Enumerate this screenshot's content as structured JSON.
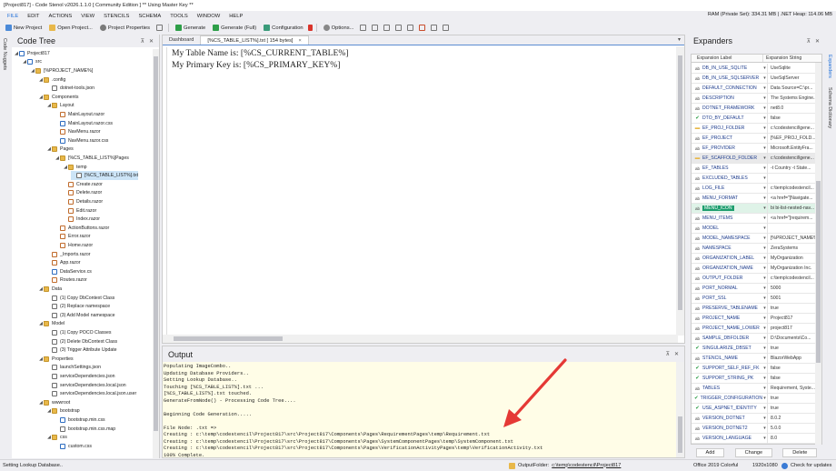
{
  "window": {
    "title": "[Project817] - Code Stenol v2026.1.1.0 [ Community Edition ] ** Using Master Key **",
    "ram": "RAM (Private Set): 334.31 MB  |  .NET Heap: 114.06 MB"
  },
  "menu": [
    "FILE",
    "EDIT",
    "ACTIONS",
    "VIEW",
    "STENCILS",
    "SCHEMA",
    "TOOLS",
    "WINDOW",
    "HELP"
  ],
  "toolbar": {
    "new_project": "New Project",
    "open_project": "Open Project...",
    "project_properties": "Project Properties",
    "generate": "Generate",
    "generate_full": "Generate (Full)",
    "configuration": "Configuration",
    "options": "Options..."
  },
  "left_strip": {
    "label": "Code Nuggets"
  },
  "code_tree": {
    "title": "Code Tree",
    "nodes": [
      {
        "label": "Project817",
        "depth": 0,
        "expander": "◢",
        "icon": "proj"
      },
      {
        "label": "src",
        "depth": 1,
        "expander": "◢",
        "icon": "code"
      },
      {
        "label": "[%PROJECT_NAME%]",
        "depth": 2,
        "expander": "◢",
        "icon": "folder"
      },
      {
        "label": ".config",
        "depth": 3,
        "expander": "◢",
        "icon": "folder"
      },
      {
        "label": "dotnet-tools.json",
        "depth": 4,
        "expander": "",
        "icon": "json"
      },
      {
        "label": "Components",
        "depth": 3,
        "expander": "◢",
        "icon": "folder"
      },
      {
        "label": "Layout",
        "depth": 4,
        "expander": "◢",
        "icon": "folder"
      },
      {
        "label": "MainLayout.razor",
        "depth": 5,
        "expander": "",
        "icon": "razor"
      },
      {
        "label": "MainLayout.razor.css",
        "depth": 5,
        "expander": "",
        "icon": "cs"
      },
      {
        "label": "NavMenu.razor",
        "depth": 5,
        "expander": "",
        "icon": "razor"
      },
      {
        "label": "NavMenu.razor.css",
        "depth": 5,
        "expander": "",
        "icon": "cs"
      },
      {
        "label": "Pages",
        "depth": 4,
        "expander": "◢",
        "icon": "folder"
      },
      {
        "label": "[%CS_TABLE_LIST%]Pages",
        "depth": 5,
        "expander": "◢",
        "icon": "folder"
      },
      {
        "label": "temp",
        "depth": 6,
        "expander": "◢",
        "icon": "folder"
      },
      {
        "label": "[%CS_TABLE_LIST%].txt",
        "depth": 7,
        "expander": "",
        "icon": "file",
        "selected": true
      },
      {
        "label": "Create.razor",
        "depth": 6,
        "expander": "",
        "icon": "razor"
      },
      {
        "label": "Delete.razor",
        "depth": 6,
        "expander": "",
        "icon": "razor"
      },
      {
        "label": "Details.razor",
        "depth": 6,
        "expander": "",
        "icon": "razor"
      },
      {
        "label": "Edit.razor",
        "depth": 6,
        "expander": "",
        "icon": "razor"
      },
      {
        "label": "Index.razor",
        "depth": 6,
        "expander": "",
        "icon": "razor"
      },
      {
        "label": "ActionButtons.razor",
        "depth": 5,
        "expander": "",
        "icon": "razor"
      },
      {
        "label": "Error.razor",
        "depth": 5,
        "expander": "",
        "icon": "razor"
      },
      {
        "label": "Home.razor",
        "depth": 5,
        "expander": "",
        "icon": "razor"
      },
      {
        "label": "_Imports.razor",
        "depth": 4,
        "expander": "",
        "icon": "razor"
      },
      {
        "label": "App.razor",
        "depth": 4,
        "expander": "",
        "icon": "razor"
      },
      {
        "label": "DataService.cs",
        "depth": 4,
        "expander": "",
        "icon": "cs"
      },
      {
        "label": "Routes.razor",
        "depth": 4,
        "expander": "",
        "icon": "razor"
      },
      {
        "label": "Data",
        "depth": 3,
        "expander": "◢",
        "icon": "folder"
      },
      {
        "label": "(1) Copy DbContext Class",
        "depth": 4,
        "expander": "",
        "icon": "file"
      },
      {
        "label": "(2) Replace namespace",
        "depth": 4,
        "expander": "",
        "icon": "file"
      },
      {
        "label": "(3) Add Model namespace",
        "depth": 4,
        "expander": "",
        "icon": "file"
      },
      {
        "label": "Model",
        "depth": 3,
        "expander": "◢",
        "icon": "folder"
      },
      {
        "label": "(1) Copy POCO Classes",
        "depth": 4,
        "expander": "",
        "icon": "file"
      },
      {
        "label": "(2) Delete DbContext Class",
        "depth": 4,
        "expander": "",
        "icon": "file"
      },
      {
        "label": "(3) Trigger Attribute Update",
        "depth": 4,
        "expander": "",
        "icon": "file"
      },
      {
        "label": "Properties",
        "depth": 3,
        "expander": "◢",
        "icon": "folder"
      },
      {
        "label": "launchSettings.json",
        "depth": 4,
        "expander": "",
        "icon": "json"
      },
      {
        "label": "serviceDependencies.json",
        "depth": 4,
        "expander": "",
        "icon": "json"
      },
      {
        "label": "serviceDependencies.local.json",
        "depth": 4,
        "expander": "",
        "icon": "json"
      },
      {
        "label": "serviceDependencies.local.json.user",
        "depth": 4,
        "expander": "",
        "icon": "file"
      },
      {
        "label": "wwwroot",
        "depth": 3,
        "expander": "◢",
        "icon": "folder"
      },
      {
        "label": "bootstrap",
        "depth": 4,
        "expander": "◢",
        "icon": "folder"
      },
      {
        "label": "bootstrap.min.css",
        "depth": 5,
        "expander": "",
        "icon": "cs"
      },
      {
        "label": "bootstrap.min.css.map",
        "depth": 5,
        "expander": "",
        "icon": "file"
      },
      {
        "label": "css",
        "depth": 4,
        "expander": "◢",
        "icon": "folder"
      },
      {
        "label": "custom.css",
        "depth": 5,
        "expander": "",
        "icon": "cs"
      }
    ]
  },
  "editor": {
    "tabs": [
      {
        "label": "Dashboard",
        "active": false
      },
      {
        "label": "[%CS_TABLE_LIST%].txt [ 154 bytes]",
        "active": true,
        "close": "×"
      }
    ],
    "lines": [
      "My Table Name is: [%CS_CURRENT_TABLE%]",
      "My Primary Key is: [%CS_PRIMARY_KEY%]"
    ]
  },
  "output": {
    "title": "Output",
    "lines": [
      "Populating ImageCombo..",
      "Updating Database Providers..",
      "Setting Lookup Database..",
      "Touching [%CS_TABLE_LIST%].txt ...",
      "[%CS_TABLE_LIST%].txt touched.",
      "GenerateFromNode() - Processing Code Tree....",
      "",
      "Beginning Code Generation.....",
      "",
      "File Node: .txt =>",
      "Creating : c:\\temp\\codestencil\\Project817\\src\\Project817\\Components\\Pages\\RequirementPages\\temp\\Requirement.txt",
      "Creating : c:\\temp\\codestencil\\Project817\\src\\Project817\\Components\\Pages\\SystemComponentPages\\temp\\SystemComponent.txt",
      "Creating : c:\\temp\\codestencil\\Project817\\src\\Project817\\Components\\Pages\\VerificationActivityPages\\temp\\VerificationActivity.txt",
      "100% Complete."
    ]
  },
  "expanders": {
    "title": "Expanders",
    "col_label": "Expansion Label",
    "col_string": "Expansion String",
    "rows": [
      {
        "icon": "ab",
        "label": "DB_IN_USE_SQLITE",
        "value": "UseSqlite"
      },
      {
        "icon": "ab",
        "label": "DB_IN_USE_SQLSERVER",
        "value": "UseSqlServer"
      },
      {
        "icon": "ab",
        "label": "DEFAULT_CONNECTION",
        "value": "Data Source=C:\\pr..."
      },
      {
        "icon": "ab",
        "label": "DESCRIPTION",
        "value": "The Systems Engine..."
      },
      {
        "icon": "ab",
        "label": "DOTNET_FRAMEWORK",
        "value": "net8.0"
      },
      {
        "icon": "check",
        "label": "DTO_BY_DEFAULT",
        "value": "false"
      },
      {
        "icon": "folder",
        "label": "EF_PROJ_FOLDER",
        "value": "c:\\codestencil\\gene..."
      },
      {
        "icon": "ab",
        "label": "EF_PROJECT",
        "value": "[%EF_PROJ_FOLD..."
      },
      {
        "icon": "ab",
        "label": "EF_PROVIDER",
        "value": "Microsoft.EntityFra..."
      },
      {
        "icon": "folder",
        "label": "EF_SCAFFOLD_FOLDER",
        "value": "c:\\codestencil\\gene...",
        "shade": true
      },
      {
        "icon": "ab",
        "label": "EF_TABLES",
        "value": "-t Country -t State..."
      },
      {
        "icon": "ab",
        "label": "EXCLUDED_TABLES",
        "value": ""
      },
      {
        "icon": "ab",
        "label": "LOG_FILE",
        "value": "c:\\temp\\codestencil..."
      },
      {
        "icon": "ab",
        "label": "MENU_FORMAT",
        "value": "<a href=\"[Navigate..."
      },
      {
        "icon": "ab",
        "label": "MENU_ICON",
        "value": "bi bi-list-nested-nav...",
        "highlight": true
      },
      {
        "icon": "ab",
        "label": "MENU_ITEMS",
        "value": "<a href=\"[requirem..."
      },
      {
        "icon": "ab",
        "label": "MODEL",
        "value": ""
      },
      {
        "icon": "ab",
        "label": "MODEL_NAMESPACE",
        "value": "[%PROJECT_NAME%..."
      },
      {
        "icon": "ab",
        "label": "NAMESPACE",
        "value": "ZeraSystems"
      },
      {
        "icon": "ab",
        "label": "ORGANIZATION_LABEL",
        "value": "MyOrganization"
      },
      {
        "icon": "ab",
        "label": "ORGANIZATION_NAME",
        "value": "MyOrganization Inc."
      },
      {
        "icon": "ab",
        "label": "OUTPUT_FOLDER",
        "value": "c:\\temp\\codestencil..."
      },
      {
        "icon": "ab",
        "label": "PORT_NORMAL",
        "value": "5000"
      },
      {
        "icon": "ab",
        "label": "PORT_SSL",
        "value": "5001"
      },
      {
        "icon": "ab",
        "label": "PRESERVE_TABLENAME",
        "value": "true"
      },
      {
        "icon": "ab",
        "label": "PROJECT_NAME",
        "value": "Project817"
      },
      {
        "icon": "ab",
        "label": "PROJECT_NAME_LOWER",
        "value": "project817"
      },
      {
        "icon": "ab",
        "label": "SAMPLE_DBFOLDER",
        "value": "D:\\Documents\\Co..."
      },
      {
        "icon": "check",
        "label": "SINGULARIZE_DBSET",
        "value": "true"
      },
      {
        "icon": "ab",
        "label": "STENCIL_NAME",
        "value": "BlazorWebApp"
      },
      {
        "icon": "check",
        "label": "SUPPORT_SELF_REF_FK",
        "value": "false"
      },
      {
        "icon": "check",
        "label": "SUPPORT_STRING_PK",
        "value": "false"
      },
      {
        "icon": "ab",
        "label": "TABLES",
        "value": "Requirement, Syste..."
      },
      {
        "icon": "check",
        "label": "TRIGGER_CONFIGURATION",
        "value": "true"
      },
      {
        "icon": "check",
        "label": "USE_ASPNET_IDENTITY",
        "value": "true"
      },
      {
        "icon": "ab",
        "label": "VERSION_DOTNET",
        "value": "8.0.2"
      },
      {
        "icon": "ab",
        "label": "VERSION_DOTNET2",
        "value": "5.0.0"
      },
      {
        "icon": "ab",
        "label": "VERSION_LANGUAGE",
        "value": "8.0"
      }
    ],
    "buttons": {
      "add": "Add",
      "change": "Change",
      "delete": "Delete"
    }
  },
  "right_strip": {
    "tab1": "Expanders",
    "tab2": "Schema Dictionary"
  },
  "status": {
    "left": "Setting Lookup Database..",
    "output_folder_label": "OutputFolder:",
    "output_folder": "c:\\temp\\codestencil\\Project817",
    "theme": "Office 2019 Colorful",
    "resolution": "1920x1080",
    "updates": "Check for updates"
  },
  "colors": {
    "accent": "#1e6fd9",
    "highlight_row": "#1e9e6e",
    "output_bg": "#fffde7",
    "arrow": "#e53935"
  }
}
